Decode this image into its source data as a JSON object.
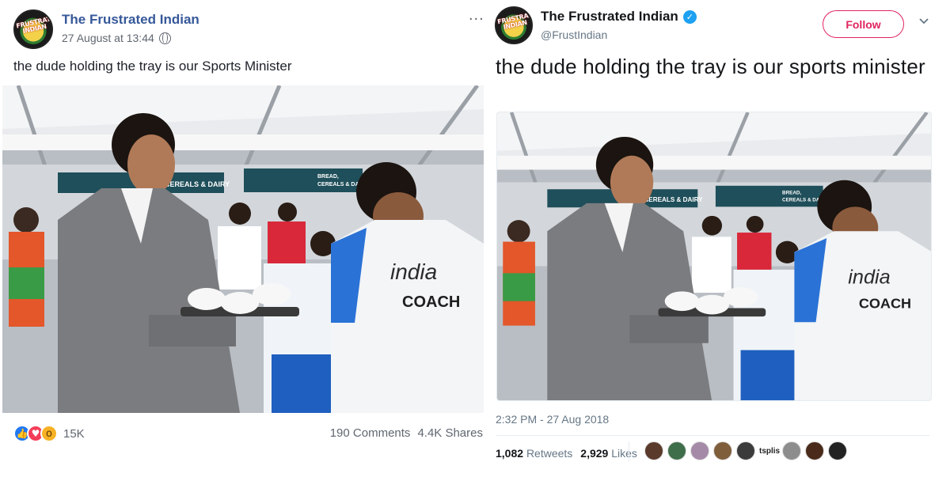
{
  "facebook": {
    "page_name": "The Frustrated India",
    "page_name_full": "The Frustrated Indian",
    "timestamp": "27 August at 13:44",
    "post_text": "the dude holding the tray is our Sports Minister",
    "more_icon": "...",
    "reaction_count": "15K",
    "comments": "190 Comments",
    "shares": "4.4K Shares",
    "avatar_text": "FRUSTRATED INDIAN",
    "photo": {
      "sign_1": "CEREALS & DAIRY",
      "sign_2_line1": "BREAD,",
      "sign_2_line2": "CEREALS & DAIRY",
      "shirt_line1": "india",
      "shirt_line2": "COACH"
    }
  },
  "twitter": {
    "display_name": "The Frustrated Indian",
    "handle": "@FrustIndian",
    "follow_label": "Follow",
    "tweet_text": "the dude holding the tray is our sports minister",
    "timestamp": "2:32 PM - 27 Aug 2018",
    "retweets_count": "1,082",
    "retweets_label": "Retweets",
    "likes_count": "2,929",
    "likes_label": "Likes",
    "liker_text": "tsplis",
    "verified_mark": "✓",
    "avatar_text": "FRUSTRATED INDIAN",
    "photo": {
      "sign_1": "CEREALS & DAIRY",
      "sign_2_line1": "BREAD,",
      "sign_2_line2": "CEREALS & DAIRY",
      "shirt_line1": "india",
      "shirt_line2": "COACH"
    }
  },
  "colors": {
    "fb_link": "#365899",
    "tw_follow": "#e0245e",
    "tw_verified": "#1da1f2"
  }
}
